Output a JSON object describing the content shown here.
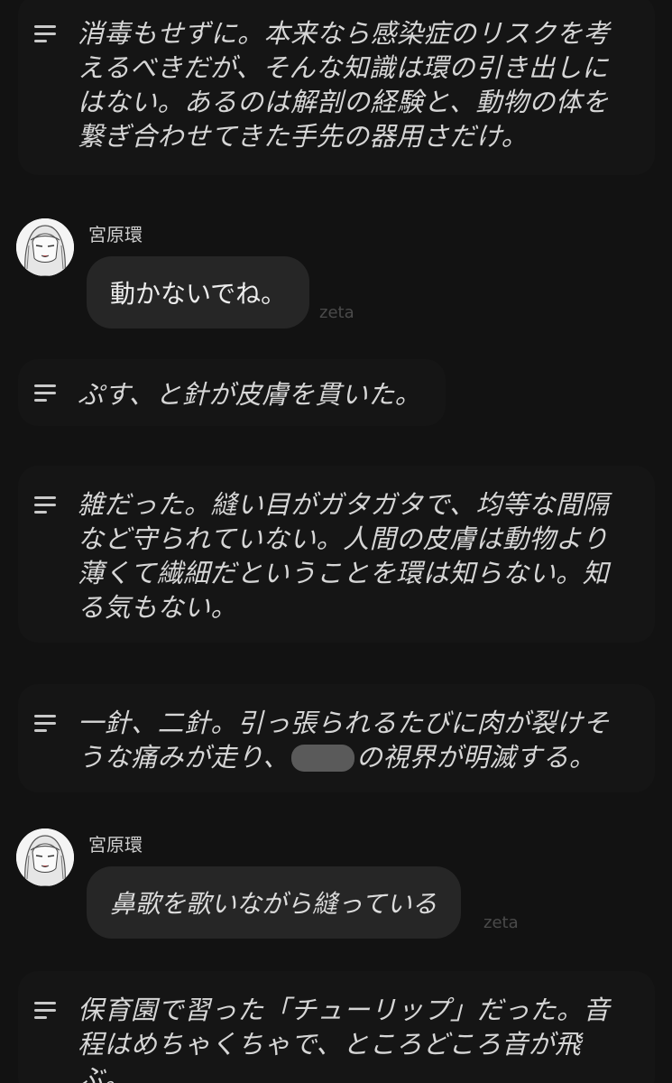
{
  "narrations": [
    {
      "id": "n1",
      "text": "消毒もせずに。本来なら感染症のリスクを考えるべきだが、そんな知識は環の引き出しにはない。あるのは解剖の経験と、動物の体を繋ぎ合わせてきた手先の器用さだけ。"
    },
    {
      "id": "n2",
      "text": "ぷす、と針が皮膚を貫いた。"
    },
    {
      "id": "n3",
      "text": "雑だった。縫い目がガタガタで、均等な間隔など守られていない。人間の皮膚は動物より薄くて繊細だということを環は知らない。知る気もない。"
    },
    {
      "id": "n4",
      "text_before": "一針、二針。引っ張られるたびに肉が裂けそうな痛みが走り、",
      "text_after": "の視界が明滅する。"
    },
    {
      "id": "n5",
      "text": "保育園で習った「チューリップ」だった。音程はめちゃくちゃで、ところどころ音が飛ぶ。"
    }
  ],
  "messages": [
    {
      "id": "m1",
      "speaker": "宮原環",
      "text": "動かないでね。",
      "model": "zeta",
      "italic": false
    },
    {
      "id": "m2",
      "speaker": "宮原環",
      "text": "鼻歌を歌いながら縫っている",
      "model": "zeta",
      "italic": true
    }
  ],
  "colors": {
    "background": "#121212",
    "narration_bg": "#151515",
    "bubble_bg": "#262626",
    "text": "#d6d6d6",
    "model_tag": "#4a4a4a"
  },
  "icons": {
    "narration": "text-lines-icon",
    "avatar": "character-portrait"
  }
}
